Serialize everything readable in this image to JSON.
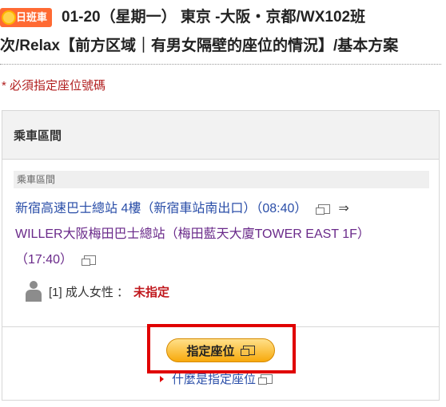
{
  "header": {
    "badge": "日班車",
    "line1": "01-20（星期一） 東京 -大阪・京都/WX102班",
    "line2": "次/Relax【前方区域｜有男女隔壁的座位的情況】/基本方案"
  },
  "required_note": "* 必須指定座位號碼",
  "panel": {
    "title": "乘車區間",
    "sub_label": "乘車區間",
    "departure": "新宿高速巴士總站 4樓（新宿車站南出口）（08:40）",
    "arrow": "⇒",
    "arrival_line1": "WILLER大阪梅田巴士總站（梅田藍天大廈TOWER EAST 1F）",
    "arrival_line2": "（17:40）",
    "passenger": {
      "label": "[1] 成人女性 ：",
      "status": "未指定"
    }
  },
  "actions": {
    "seat_button": "指定座位",
    "help_link": "什麼是指定座位"
  },
  "colors": {
    "badge": "#ff6a33",
    "highlight": "#e00000",
    "button": "#f7a90c",
    "link": "#2a4ea8"
  }
}
